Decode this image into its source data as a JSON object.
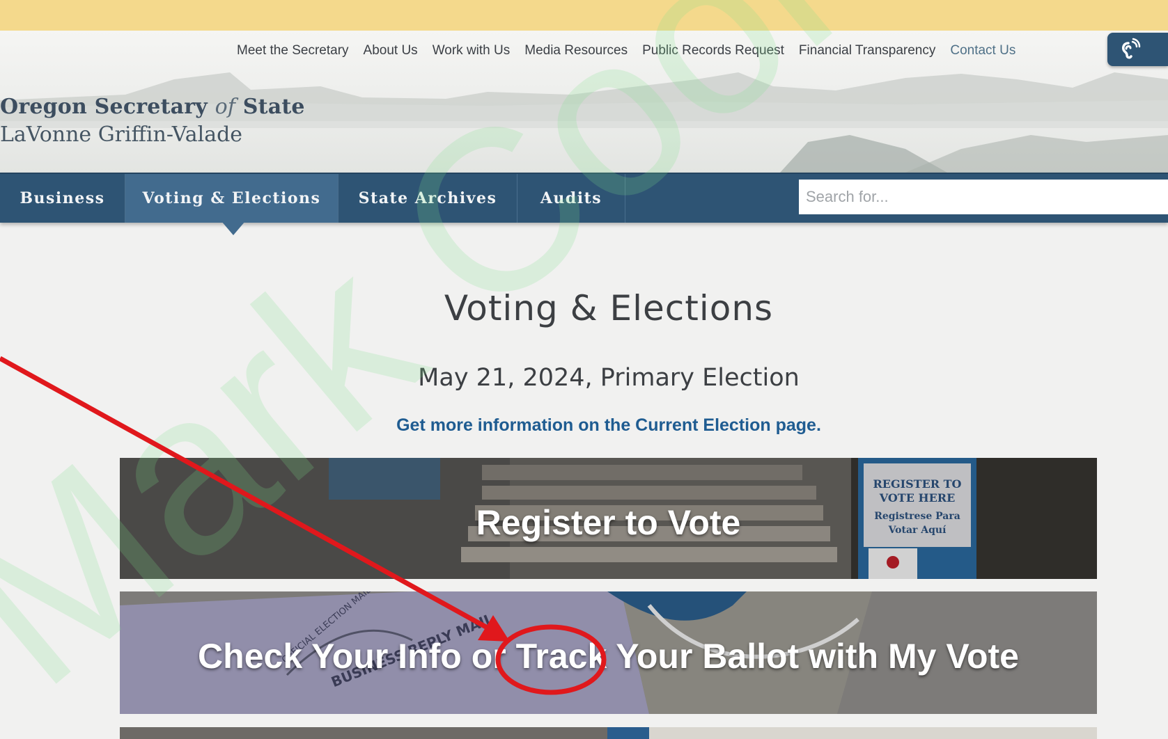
{
  "utility_nav": {
    "links": [
      "Meet the Secretary",
      "About Us",
      "Work with Us",
      "Media Resources",
      "Public Records Request",
      "Financial Transparency",
      "Contact Us"
    ]
  },
  "accessibility_icon": "ear-hearing-icon",
  "logo": {
    "title_part1": "Oregon Secretary ",
    "title_of": "of",
    "title_part2": " State",
    "official_name": "LaVonne Griffin-Valade"
  },
  "main_nav": {
    "items": [
      "Business",
      "Voting & Elections",
      "State Archives",
      "Audits"
    ],
    "active": "Voting & Elections"
  },
  "search": {
    "placeholder": "Search for..."
  },
  "content": {
    "title": "Voting & Elections",
    "election": "May 21, 2024, Primary Election",
    "info_link": "Get more information on the Current Election page."
  },
  "tiles": [
    {
      "label": "Register to Vote",
      "sign_line1": "REGISTER TO",
      "sign_line2": "VOTE HERE",
      "sign_line3": "Registrese Para",
      "sign_line4": "Votar Aquí"
    },
    {
      "label": "Check Your Info or Track Your Ballot with My Vote",
      "envelope_text1": "BUSINESS REPLY MAIL",
      "envelope_text2": "OFFICIAL ELECTION MAIL"
    }
  ],
  "annotations": {
    "watermark": "Mark Cook",
    "arrow_color": "#e0181c",
    "circled_word": "Track"
  },
  "colors": {
    "banner": "#f4d98c",
    "nav": "#2e5474",
    "nav_active": "#426b8e",
    "link": "#1f5c91"
  }
}
